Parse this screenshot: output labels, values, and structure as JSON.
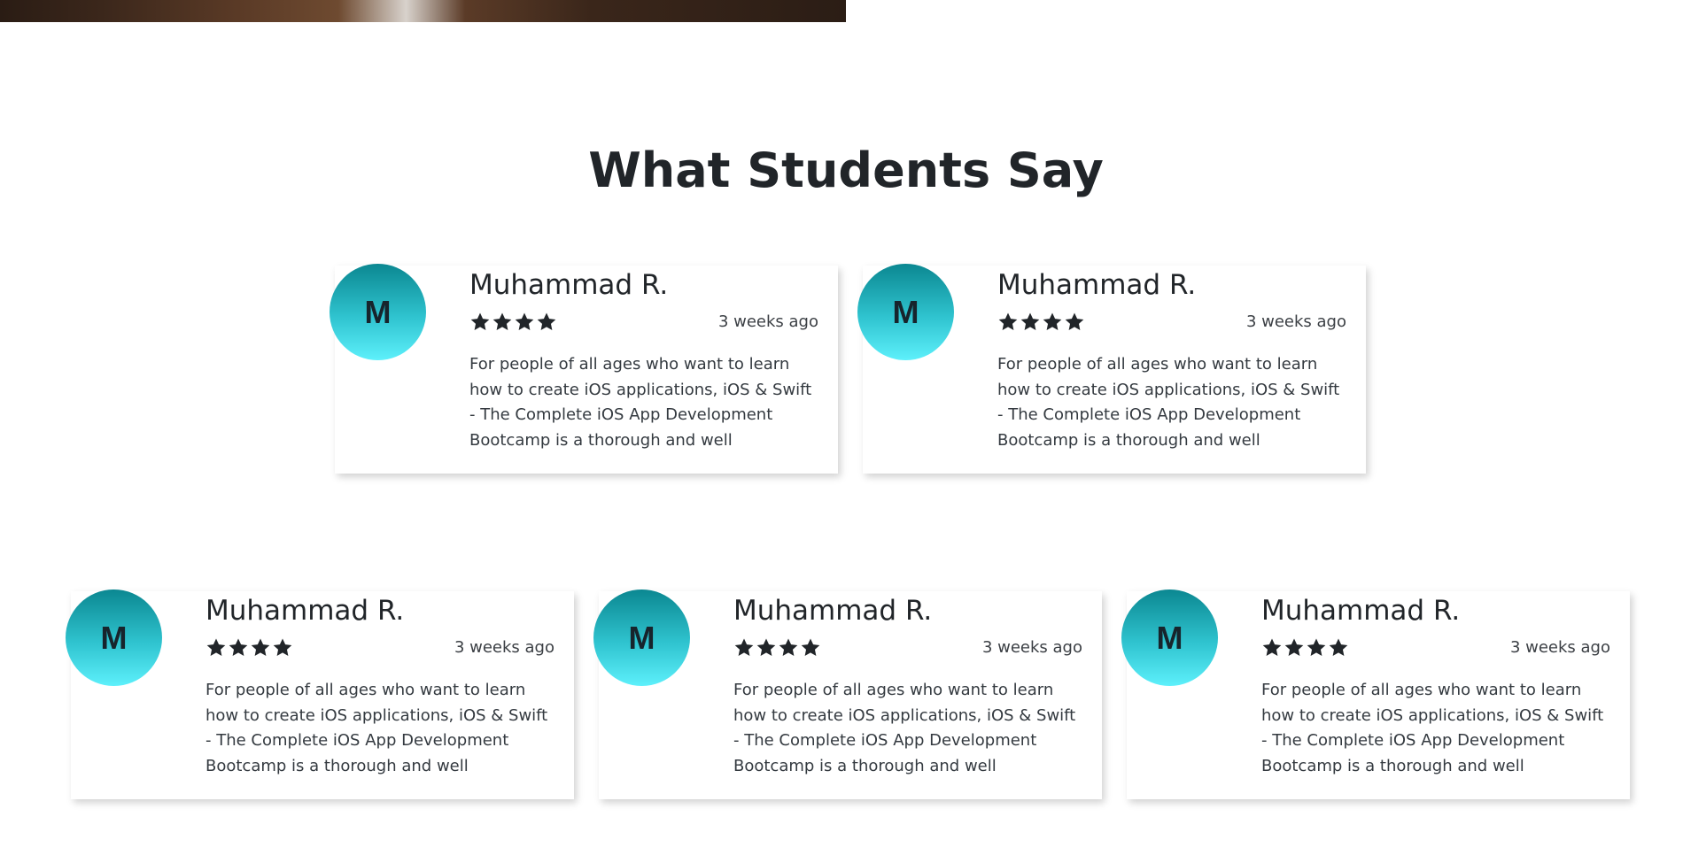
{
  "section": {
    "title": "What Students Say"
  },
  "colors": {
    "avatar_gradient_top": "#0b8791",
    "avatar_gradient_bottom": "#5df0fb",
    "text_dark": "#212529"
  },
  "reviews": [
    {
      "initial": "M",
      "name": "Muhammad R.",
      "rating": 4,
      "time": "3 weeks ago",
      "text": "For people of all ages who want to learn how to create iOS applications, iOS & Swift - The Complete iOS App Development Bootcamp is a thorough and well"
    },
    {
      "initial": "M",
      "name": "Muhammad R.",
      "rating": 4,
      "time": "3 weeks ago",
      "text": "For people of all ages who want to learn how to create iOS applications, iOS & Swift - The Complete iOS App Development Bootcamp is a thorough and well"
    },
    {
      "initial": "M",
      "name": "Muhammad R.",
      "rating": 4,
      "time": "3 weeks ago",
      "text": "For people of all ages who want to learn how to create iOS applications, iOS & Swift - The Complete iOS App Development Bootcamp is a thorough and well"
    },
    {
      "initial": "M",
      "name": "Muhammad R.",
      "rating": 4,
      "time": "3 weeks ago",
      "text": "For people of all ages who want to learn how to create iOS applications, iOS & Swift - The Complete iOS App Development Bootcamp is a thorough and well"
    },
    {
      "initial": "M",
      "name": "Muhammad R.",
      "rating": 4,
      "time": "3 weeks ago",
      "text": "For people of all ages who want to learn how to create iOS applications, iOS & Swift - The Complete iOS App Development Bootcamp is a thorough and well"
    }
  ]
}
